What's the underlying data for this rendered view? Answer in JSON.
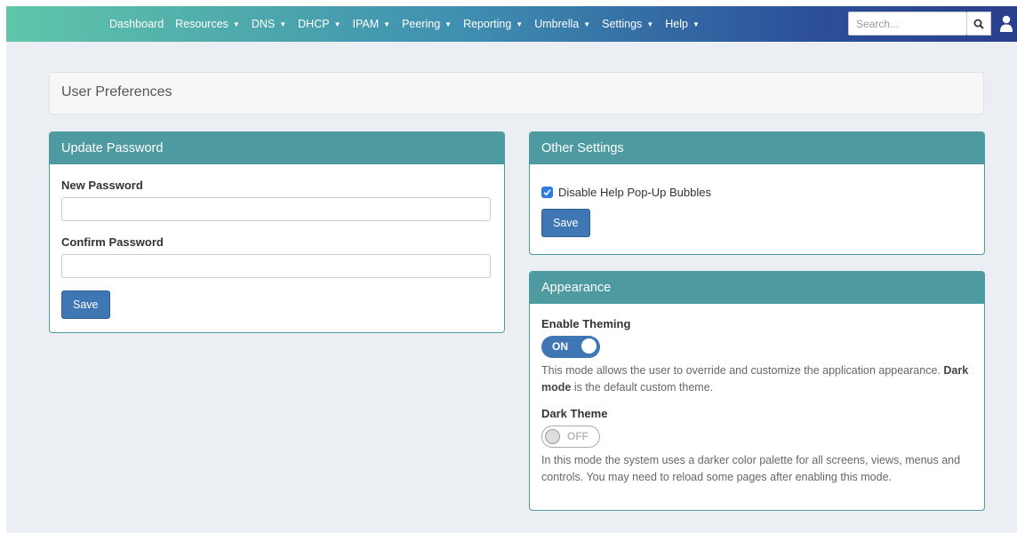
{
  "navbar": {
    "items": [
      {
        "label": "Dashboard",
        "dropdown": false
      },
      {
        "label": "Resources",
        "dropdown": true
      },
      {
        "label": "DNS",
        "dropdown": true
      },
      {
        "label": "DHCP",
        "dropdown": true
      },
      {
        "label": "IPAM",
        "dropdown": true
      },
      {
        "label": "Peering",
        "dropdown": true
      },
      {
        "label": "Reporting",
        "dropdown": true
      },
      {
        "label": "Umbrella",
        "dropdown": true
      },
      {
        "label": "Settings",
        "dropdown": true
      },
      {
        "label": "Help",
        "dropdown": true
      }
    ],
    "caret": "▼",
    "search_placeholder": "Search...",
    "search_icon": "search-icon",
    "user_icon": "user-icon"
  },
  "page": {
    "title": "User Preferences"
  },
  "update_password": {
    "heading": "Update Password",
    "new_password_label": "New Password",
    "new_password_value": "",
    "confirm_password_label": "Confirm Password",
    "confirm_password_value": "",
    "save_label": "Save"
  },
  "other_settings": {
    "heading": "Other Settings",
    "disable_help_label": "Disable Help Pop-Up Bubbles",
    "disable_help_checked": true,
    "save_label": "Save"
  },
  "appearance": {
    "heading": "Appearance",
    "enable_theming_label": "Enable Theming",
    "enable_theming_state": "ON",
    "enable_theming_desc_1": "This mode allows the user to override and customize the application appearance.",
    "enable_theming_desc_bold": "Dark mode",
    "enable_theming_desc_2": " is the default custom theme.",
    "dark_theme_label": "Dark Theme",
    "dark_theme_state": "OFF",
    "dark_theme_desc": "In this mode the system uses a darker color palette for all screens, views, menus and controls. You may need to reload some pages after enabling this mode."
  },
  "colors": {
    "panel_header": "#4e9aa1",
    "button": "#3f77b5",
    "page_bg": "#ebeef2"
  }
}
